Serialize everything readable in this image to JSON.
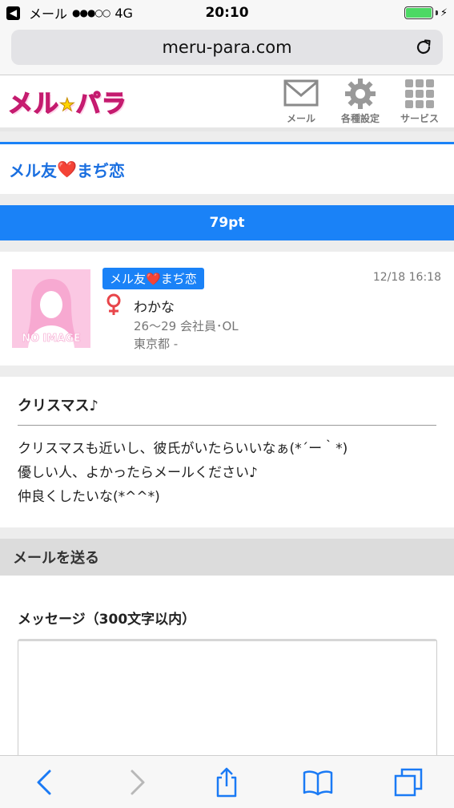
{
  "status_bar": {
    "back_app": "メール",
    "signal": "●●●○○",
    "network": "4G",
    "time": "20:10"
  },
  "browser": {
    "url": "meru-para.com"
  },
  "site_header": {
    "logo_left": "メル",
    "logo_star": "★",
    "logo_right": "パラ",
    "nav": [
      {
        "label": "メール",
        "icon": "mail-icon"
      },
      {
        "label": "各種設定",
        "icon": "gear-icon"
      },
      {
        "label": "サービス",
        "icon": "grid-icon"
      }
    ]
  },
  "board": {
    "title_left": "メル友",
    "title_heart": "❤️",
    "title_right": "まぢ恋",
    "points": "79pt"
  },
  "profile": {
    "tag_left": "メル友",
    "tag_heart": "❤️",
    "tag_right": "まぢ恋",
    "datetime": "12/18 16:18",
    "gender_symbol": "♀",
    "name": "わかな",
    "info1": "26〜29 会社員･OL",
    "info2": "東京都 -",
    "avatar_text": "NO IMAGE"
  },
  "post": {
    "title": "クリスマス♪",
    "lines": [
      "クリスマスも近いし、彼氏がいたらいいなぁ(*´ー｀*)",
      "優しい人、よかったらメールください♪",
      "仲良くしたいな(*^^*)"
    ]
  },
  "send": {
    "section_title": "メールを送る",
    "message_label": "メッセージ（300文字以内）",
    "message_value": ""
  },
  "colors": {
    "accent_blue": "#1a82f7",
    "logo_pink": "#ff3e9c",
    "female_red": "#e8454a"
  }
}
